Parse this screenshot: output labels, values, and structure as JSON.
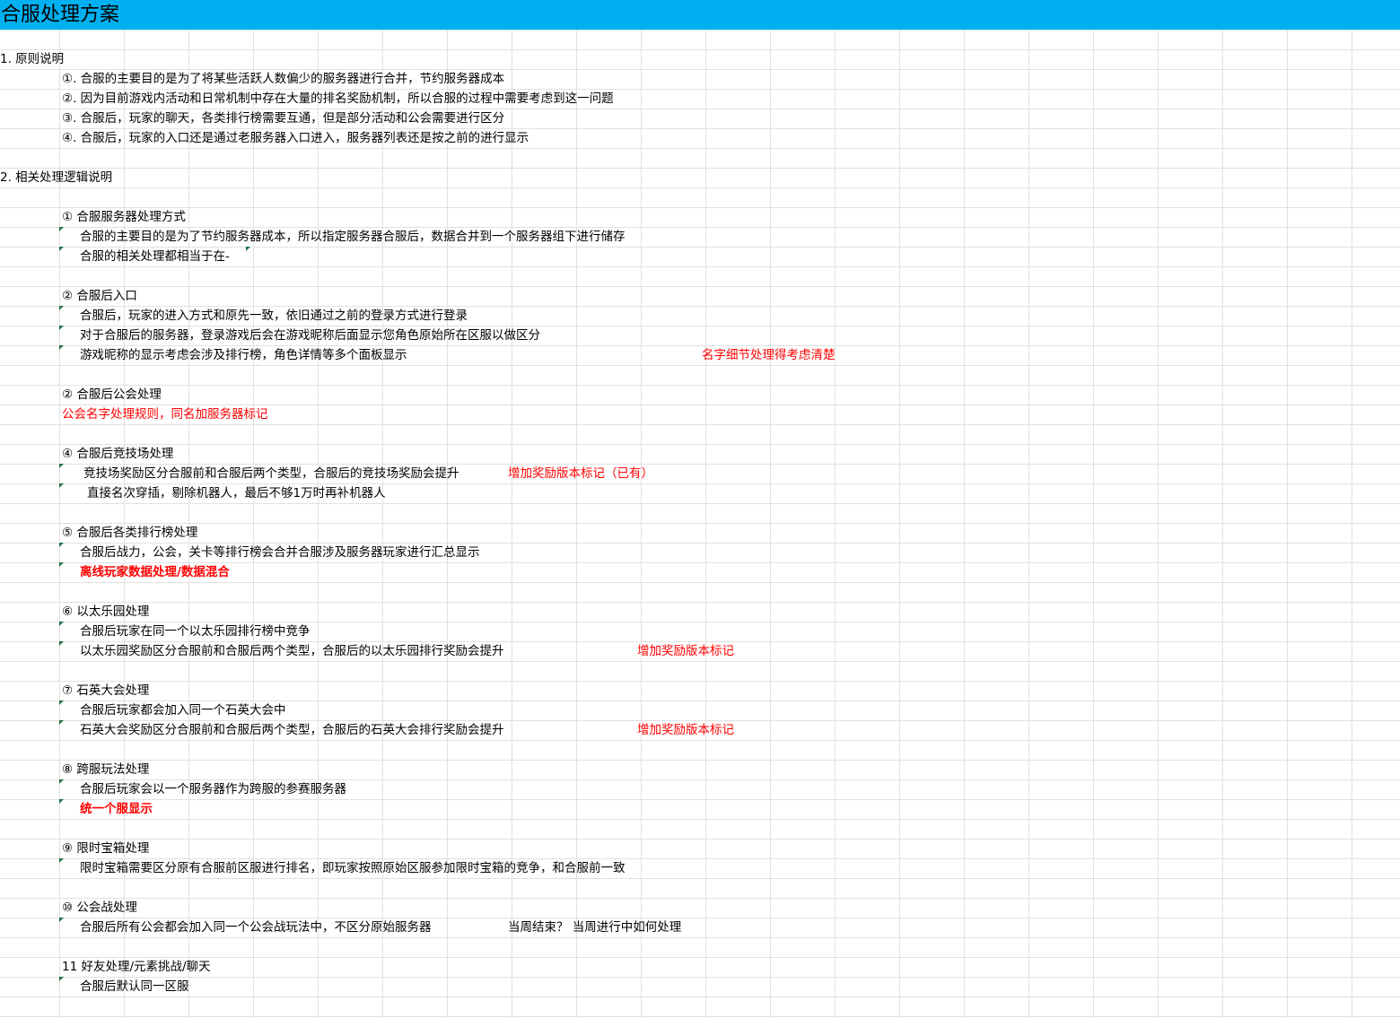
{
  "title": "合服处理方案",
  "sections": {
    "s1": "1. 原则说明",
    "p1": "①. 合服的主要目的是为了将某些活跃人数偏少的服务器进行合并，节约服务器成本",
    "p2": "②. 因为目前游戏内活动和日常机制中存在大量的排名奖励机制，所以合服的过程中需要考虑到这一问题",
    "p3": "③. 合服后，玩家的聊天，各类排行榜需要互通，但是部分活动和公会需要进行区分",
    "p4": "④. 合服后，玩家的入口还是通过老服务器入口进入，服务器列表还是按之前的进行显示",
    "s2": "2. 相关处理逻辑说明"
  },
  "items": {
    "h1": "① 合服服务器处理方式",
    "h1a": "合服的主要目的是为了节约服务器成本，所以指定服务器合服后，数据合并到一个服务器组下进行储存",
    "h1b": "合服的相关处理都相当于在-",
    "h2": "② 合服后入口",
    "h2a": "合服后，玩家的进入方式和原先一致，依旧通过之前的登录方式进行登录",
    "h2b": "对于合服后的服务器，登录游戏后会在游戏昵称后面显示您角色原始所在区服以做区分",
    "h2c": "游戏昵称的显示考虑会涉及排行榜，角色详情等多个面板显示",
    "h2c_note": "名字细节处理得考虑清楚",
    "h3": "② 合服后公会处理",
    "h3_note": "公会名字处理规则，同名加服务器标记",
    "h4": "④ 合服后竞技场处理",
    "h4a": "竞技场奖励区分合服前和合服后两个类型，合服后的竞技场奖励会提升",
    "h4a_note": "增加奖励版本标记（已有）",
    "h4b": "直接名次穿插，剔除机器人，最后不够1万时再补机器人",
    "h5": "⑤ 合服后各类排行榜处理",
    "h5a": "合服后战力，公会，关卡等排行榜会合并合服涉及服务器玩家进行汇总显示",
    "h5_note": "离线玩家数据处理/数据混合",
    "h6": "⑥ 以太乐园处理",
    "h6a": "合服后玩家在同一个以太乐园排行榜中竞争",
    "h6b": "以太乐园奖励区分合服前和合服后两个类型，合服后的以太乐园排行奖励会提升",
    "h6b_note": "增加奖励版本标记",
    "h7": "⑦ 石英大会处理",
    "h7a": "合服后玩家都会加入同一个石英大会中",
    "h7b": "石英大会奖励区分合服前和合服后两个类型，合服后的石英大会排行奖励会提升",
    "h7b_note": "增加奖励版本标记",
    "h8": "⑧ 跨服玩法处理",
    "h8a": "合服后玩家会以一个服务器作为跨服的参赛服务器",
    "h8_note": "统一个服显示",
    "h9": "⑨ 限时宝箱处理",
    "h9a": "限时宝箱需要区分原有合服前区服进行排名，即玩家按照原始区服参加限时宝箱的竞争，和合服前一致",
    "h10": "⑩ 公会战处理",
    "h10a": "合服后所有公会都会加入同一个公会战玩法中，不区分原始服务器",
    "h10a_note": "当周结束？ 当周进行中如何处理",
    "h11": "11 好友处理/元素挑战/聊天",
    "h11a": "合服后默认同一区服"
  }
}
